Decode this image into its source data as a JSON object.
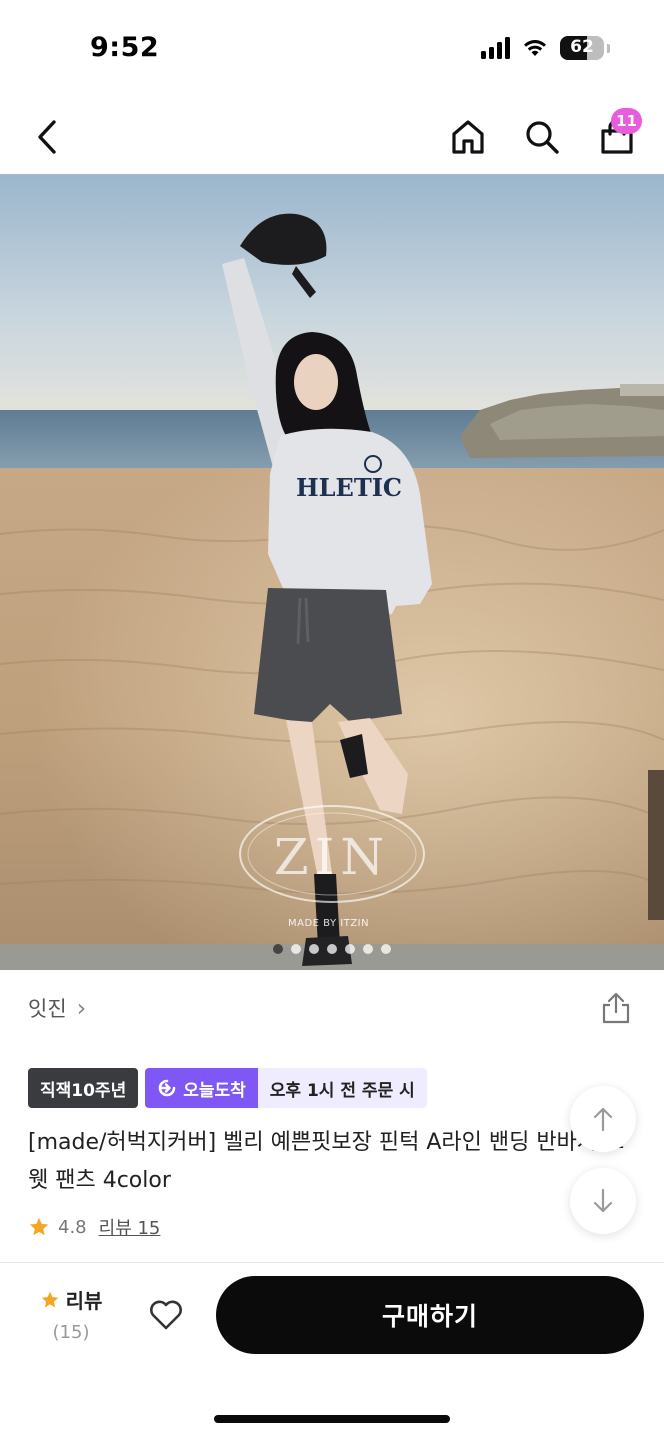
{
  "status_bar": {
    "time": "9:52",
    "battery": "62",
    "battery_level": 0.62,
    "icons": [
      "signal-icon",
      "wifi-icon",
      "battery-icon"
    ]
  },
  "nav": {
    "icons": [
      "back-icon",
      "home-icon",
      "search-icon",
      "shopping-bag-icon"
    ],
    "cart_count": "11"
  },
  "hero": {
    "watermark": "ZIN",
    "watermark_sub": "MADE BY ITZIN",
    "sweatshirt_text": "ATHLETIC",
    "slide_count": 7,
    "active_slide": 1
  },
  "store": {
    "name": "잇진",
    "chevron": "›"
  },
  "tags": {
    "anniversary": "직잭10주년",
    "delivery": "오늘도착",
    "delivery_note": "오후 1시 전 주문 시"
  },
  "product": {
    "title": "[made/허벅지커버] 벨리 예쁜핏보장 핀턱 A라인 밴딩 반바지 스웻 팬츠 4color",
    "rating": "4.8",
    "review_link": "리뷰 15"
  },
  "bottom_bar": {
    "review_label": "리뷰",
    "review_count": "(15)",
    "buy_label": "구매하기"
  },
  "colors": {
    "accent_purple": "#7e57f5",
    "badge_pink": "#e85ddc",
    "star": "#f5a623",
    "buy_button": "#0b0b0b"
  }
}
